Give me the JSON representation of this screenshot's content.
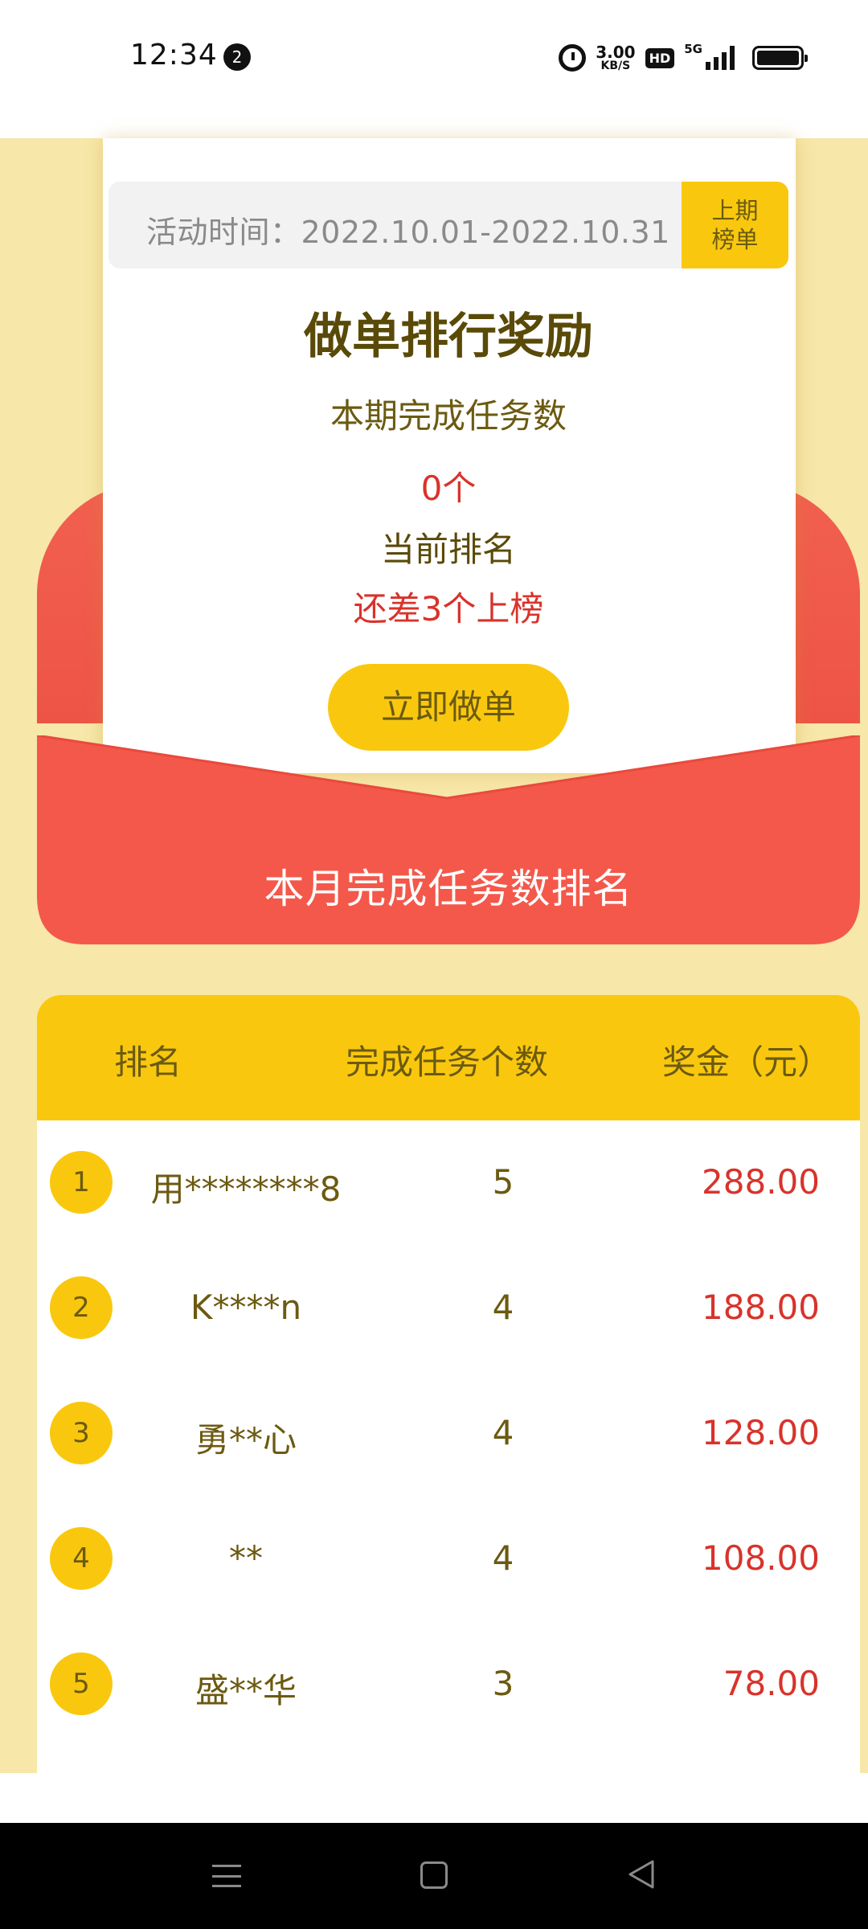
{
  "status_bar": {
    "time": "12:34",
    "notification_count": "2",
    "net_speed_value": "3.00",
    "net_speed_unit": "KB/S",
    "hd_label": "HD",
    "network_type": "5G"
  },
  "activity": {
    "date_range": "活动时间：2022.10.01-2022.10.31",
    "prev_list_line1": "上期",
    "prev_list_line2": "榜单",
    "title": "做单排行奖励",
    "period_label": "本期完成任务数",
    "task_count": "0个",
    "rank_label": "当前排名",
    "rank_gap": "还差3个上榜",
    "do_button": "立即做单",
    "month_rank_title": "本月完成任务数排名"
  },
  "ranking": {
    "headers": [
      "排名",
      "完成任务个数",
      "奖金（元）"
    ],
    "rows": [
      {
        "rank": "1",
        "name": "用********8",
        "count": "5",
        "bonus": "288.00"
      },
      {
        "rank": "2",
        "name": "K****n",
        "count": "4",
        "bonus": "188.00"
      },
      {
        "rank": "3",
        "name": "勇**心",
        "count": "4",
        "bonus": "128.00"
      },
      {
        "rank": "4",
        "name": "**",
        "count": "4",
        "bonus": "108.00"
      },
      {
        "rank": "5",
        "name": "盛**华",
        "count": "3",
        "bonus": "78.00"
      }
    ]
  },
  "colors": {
    "accent_yellow": "#f9c80e",
    "envelope_red": "#f4584a",
    "page_bg": "#f7e7a8",
    "text_brown": "#6b5a10",
    "highlight_red": "#d8332b"
  },
  "nav_bar": {
    "icons": [
      "menu-icon",
      "home-icon",
      "back-icon"
    ]
  }
}
